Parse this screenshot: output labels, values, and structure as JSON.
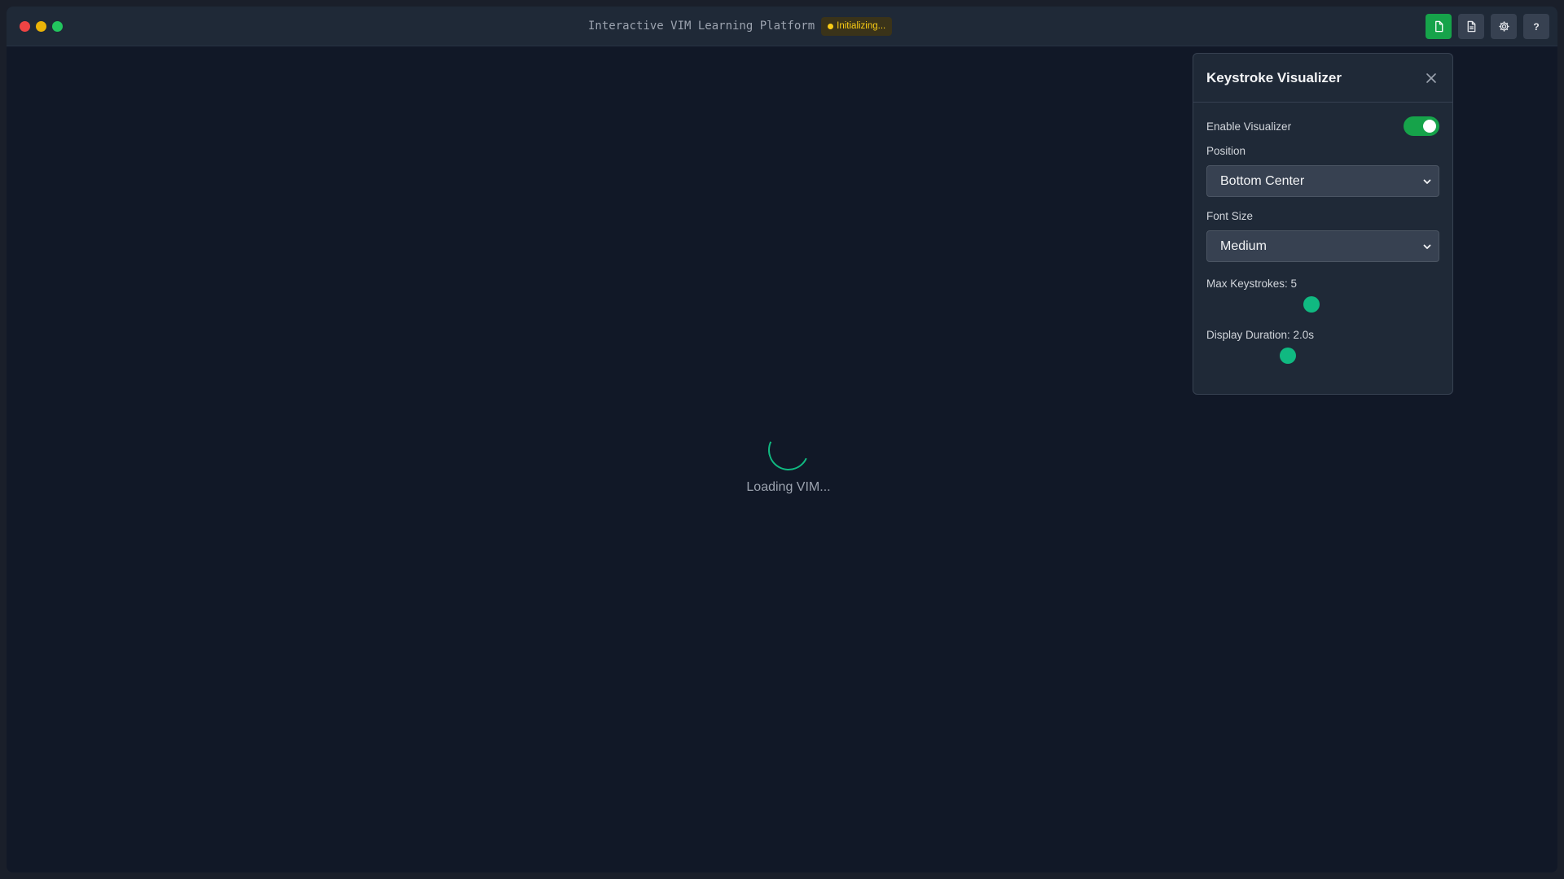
{
  "window": {
    "title": "Interactive VIM Learning Platform",
    "status": "Initializing...",
    "status_color": "#facc15",
    "accent_color": "#16a34a"
  },
  "toolbar": {
    "buttons": [
      {
        "icon": "file-icon",
        "active": true
      },
      {
        "icon": "document-icon",
        "active": false
      },
      {
        "icon": "gear-icon",
        "active": false
      },
      {
        "icon": "help-icon",
        "label": "?",
        "active": false
      }
    ]
  },
  "main": {
    "loading_text": "Loading VIM..."
  },
  "panel": {
    "title": "Keystroke Visualizer",
    "enable_label": "Enable Visualizer",
    "enabled": true,
    "position_label": "Position",
    "position_value": "Bottom Center",
    "font_size_label": "Font Size",
    "font_size_value": "Medium",
    "max_keystrokes_label": "Max Keystrokes: 5",
    "max_keystrokes_level": 0.45,
    "display_duration_label": "Display Duration: 2.0s",
    "display_duration_level": 0.35
  }
}
